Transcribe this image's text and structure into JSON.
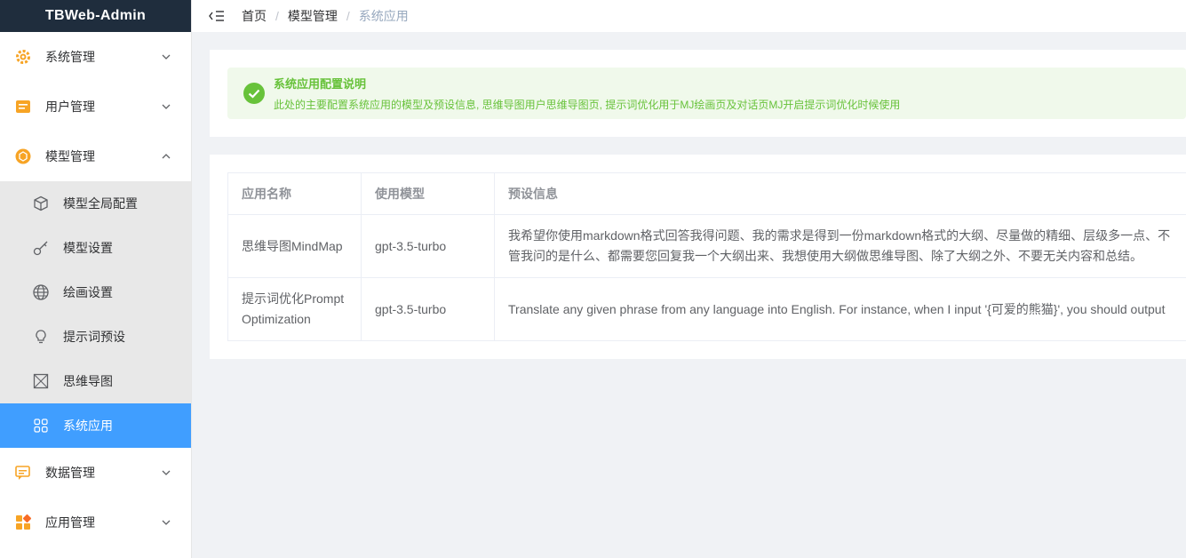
{
  "app": {
    "title": "TBWeb-Admin"
  },
  "sidebar": {
    "items": [
      {
        "label": "系统管理",
        "icon": "gear-icon"
      },
      {
        "label": "用户管理",
        "icon": "user-list-icon"
      },
      {
        "label": "模型管理",
        "icon": "model-icon"
      },
      {
        "label": "数据管理",
        "icon": "chat-data-icon"
      },
      {
        "label": "应用管理",
        "icon": "apps-icon"
      }
    ],
    "sub_items": [
      {
        "label": "模型全局配置",
        "icon": "cube-icon"
      },
      {
        "label": "模型设置",
        "icon": "key-icon"
      },
      {
        "label": "绘画设置",
        "icon": "globe-icon"
      },
      {
        "label": "提示词预设",
        "icon": "lightbulb-icon"
      },
      {
        "label": "思维导图",
        "icon": "mindmap-icon"
      },
      {
        "label": "系统应用",
        "icon": "grid-icon"
      }
    ],
    "active_color": "#409eff"
  },
  "breadcrumb": [
    "首页",
    "模型管理",
    "系统应用"
  ],
  "notice": {
    "title": "系统应用配置说明",
    "description": "此处的主要配置系统应用的模型及预设信息, 思维导图用户思维导图页, 提示词优化用于MJ绘画页及对话页MJ开启提示词优化时候使用",
    "color": "#67c23a"
  },
  "table": {
    "headers": [
      "应用名称",
      "使用模型",
      "预设信息"
    ],
    "rows": [
      {
        "name": "思维导图MindMap",
        "model": "gpt-3.5-turbo",
        "preset": "我希望你使用markdown格式回答我得问题、我的需求是得到一份markdown格式的大纲、尽量做的精细、层级多一点、不管我问的是什么、都需要您回复我一个大纲出来、我想使用大纲做思维导图、除了大纲之外、不要无关内容和总结。"
      },
      {
        "name": "提示词优化PromptOptimization",
        "model": "gpt-3.5-turbo",
        "preset": "Translate any given phrase from any language into English. For instance, when I input '{可爱的熊猫}', you should output"
      }
    ]
  }
}
